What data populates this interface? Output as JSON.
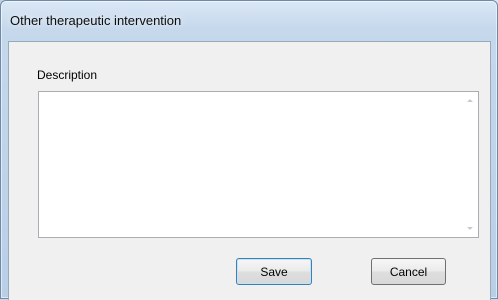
{
  "window": {
    "title": "Other therapeutic intervention"
  },
  "form": {
    "description_label": "Description",
    "description_value": ""
  },
  "buttons": {
    "save_label": "Save",
    "cancel_label": "Cancel"
  },
  "icons": {
    "scroll_up": "scroll-up-arrow-icon",
    "scroll_down": "scroll-down-arrow-icon"
  },
  "colors": {
    "frame": "#c5d8ec",
    "client": "#f0f0f0",
    "default_button_border": "#3c7fb1"
  }
}
